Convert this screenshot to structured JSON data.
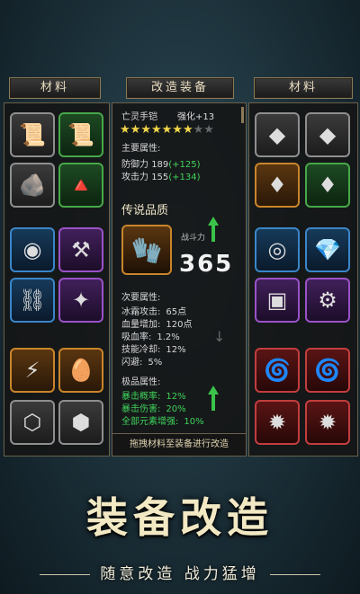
{
  "headers": {
    "left": "材料",
    "center": "改造装备",
    "right": "材料"
  },
  "left_materials": [
    {
      "icon": "scroll-icon",
      "glyph": "📜",
      "grade": "gray"
    },
    {
      "icon": "green-scroll-icon",
      "glyph": "📜",
      "grade": "green"
    },
    {
      "icon": "rune-stone-icon",
      "glyph": "🪨",
      "grade": "gray"
    },
    {
      "icon": "red-rune-stone-icon",
      "glyph": "🔺",
      "grade": "green"
    },
    {
      "icon": "jade-disc-icon",
      "glyph": "◉",
      "grade": "blue"
    },
    {
      "icon": "anvil-icon",
      "glyph": "⚒",
      "grade": "purple"
    },
    {
      "icon": "chain-icon",
      "glyph": "⛓",
      "grade": "blue"
    },
    {
      "icon": "purple-rune-icon",
      "glyph": "✦",
      "grade": "purple"
    },
    {
      "icon": "purple-gem-icon",
      "glyph": "⚡",
      "grade": "orange"
    },
    {
      "icon": "dark-egg-icon",
      "glyph": "🥚",
      "grade": "orange"
    },
    {
      "icon": "silver-hexagon-icon",
      "glyph": "⬡",
      "grade": "gray"
    },
    {
      "icon": "gear-hexagon-icon",
      "glyph": "⬢",
      "grade": "gray"
    }
  ],
  "right_materials": [
    {
      "icon": "green-crystal-icon",
      "glyph": "◆",
      "grade": "gray"
    },
    {
      "icon": "magenta-crystal-icon",
      "glyph": "◆",
      "grade": "gray"
    },
    {
      "icon": "orange-card-icon",
      "glyph": "♦",
      "grade": "orange"
    },
    {
      "icon": "dark-card-icon",
      "glyph": "♦",
      "grade": "green"
    },
    {
      "icon": "gold-ring-icon",
      "glyph": "◎",
      "grade": "blue"
    },
    {
      "icon": "blue-gem-icon",
      "glyph": "💎",
      "grade": "blue"
    },
    {
      "icon": "green-seal-icon",
      "glyph": "▣",
      "grade": "purple"
    },
    {
      "icon": "blue-gear-icon",
      "glyph": "⚙",
      "grade": "purple"
    },
    {
      "icon": "blue-vortex-icon",
      "glyph": "🌀",
      "grade": "red"
    },
    {
      "icon": "blue-vortex-icon-2",
      "glyph": "🌀",
      "grade": "red"
    },
    {
      "icon": "red-crest-icon",
      "glyph": "✹",
      "grade": "red"
    },
    {
      "icon": "dark-crest-icon",
      "glyph": "✹",
      "grade": "red"
    }
  ],
  "equipment": {
    "name": "亡灵手铠",
    "enhance": "强化+13",
    "stars_filled": 7,
    "stars_total": 9,
    "main_title": "主要属性:",
    "main_stats": [
      {
        "label": "防御力",
        "value": "189",
        "bonus": "(+125)"
      },
      {
        "label": "攻击力",
        "value": "155",
        "bonus": "(+134)"
      }
    ],
    "quality": "传说品质",
    "power_label": "战斗力",
    "power_value": "365",
    "item_icon": "gauntlet-icon",
    "secondary_title": "次要属性:",
    "secondary_stats": [
      {
        "label": "冰霜攻击:",
        "value": "65点"
      },
      {
        "label": "血量增加:",
        "value": "120点"
      },
      {
        "label": "吸血率:",
        "value": "1.2%"
      },
      {
        "label": "技能冷却:",
        "value": "12%"
      },
      {
        "label": "闪避:",
        "value": "5%"
      }
    ],
    "extreme_title": "极品属性:",
    "extreme_stats": [
      {
        "label": "暴击概率:",
        "value": "12%"
      },
      {
        "label": "暴击伤害:",
        "value": "20%"
      },
      {
        "label": "全部元素增强:",
        "value": "10%"
      }
    ],
    "hint": "拖拽材料至装备进行改造"
  },
  "promo": {
    "title": "装备改造",
    "subtitle": "随意改造 战力猛增"
  },
  "colors": {
    "accent_green": "#3ac24a",
    "gold": "#f2e9c4",
    "frame": "#8a7a58"
  }
}
